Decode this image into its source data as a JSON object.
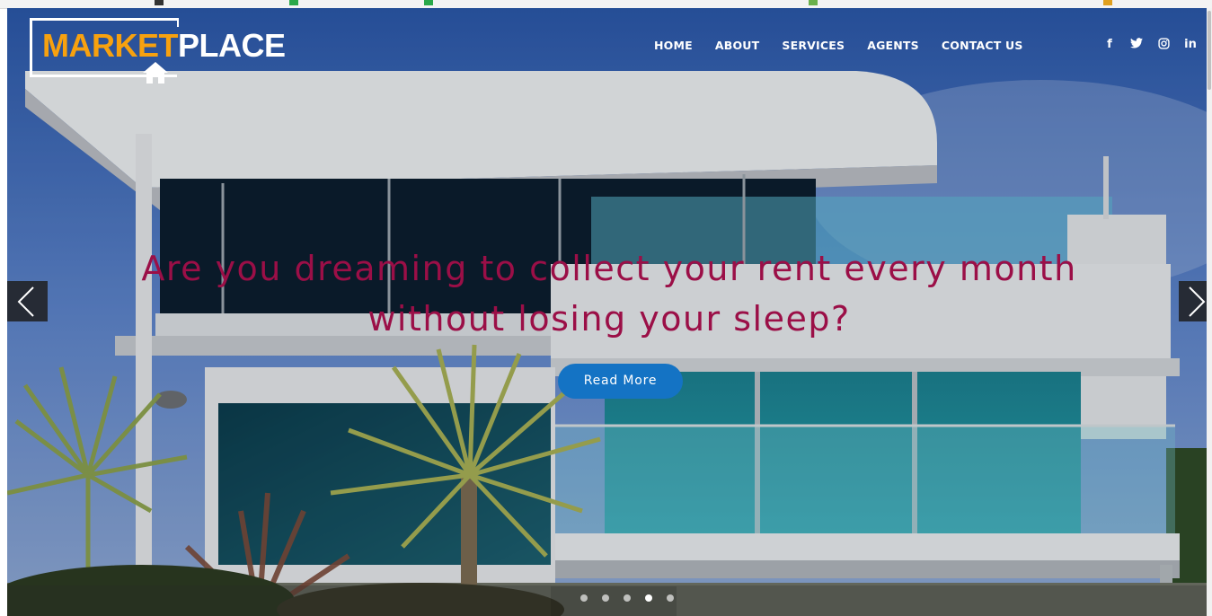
{
  "logo": {
    "part1": "MARKET",
    "part2": "PLACE"
  },
  "nav": {
    "home": "HOME",
    "about": "ABOUT",
    "services": "SERVICES",
    "agents": "AGENTS",
    "contact": "CONTACT US"
  },
  "social": {
    "facebook": "f",
    "twitter": "🐦",
    "instagram": "◎",
    "linkedin": "in"
  },
  "hero": {
    "headline_line1": "Are you dreaming to collect your rent every month",
    "headline_line2": "without losing your sleep?",
    "button": "Read More"
  },
  "carousel": {
    "slide_count": 5,
    "active_index": 3
  },
  "colors": {
    "accent_orange": "#f7a10f",
    "headline": "#9b0f47",
    "button_blue": "#1473c4"
  },
  "icons": {
    "logo": "house-icon",
    "prev": "chevron-left-icon",
    "next": "chevron-right-icon",
    "social": [
      "facebook-icon",
      "twitter-icon",
      "instagram-icon",
      "linkedin-icon"
    ]
  }
}
